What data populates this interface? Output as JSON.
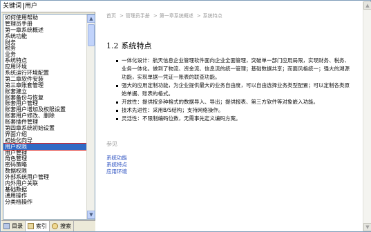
{
  "keyword": {
    "label": "关键词",
    "value": "用户"
  },
  "index_items": [
    "如何使用帮助",
    "管理员手册",
    "第一章系统概述",
    "系统功能",
    "财务",
    "税务",
    "业务",
    "系统特点",
    "应用环境",
    "系统运行环境配置",
    "第二章软件安装",
    "第三章账套管理",
    "账套建立",
    "账套备份与恢复",
    "账套用户管理",
    "账套用户增加及权限设置",
    "账套用户修改、删除",
    "账套插件管理",
    "第四章系统初始设置",
    "界面介绍",
    "初始化向导",
    "用户权限",
    "用户管理",
    "角色管理",
    "密码策略",
    "数据权限",
    "外部系统用户管理",
    "内外用户关联",
    "基础数据",
    "通用操作",
    "分类档操作"
  ],
  "selected_index": 21,
  "tabs": [
    {
      "label": "目录",
      "icon": "book-icon"
    },
    {
      "label": "索引",
      "icon": "index-icon"
    },
    {
      "label": "搜索",
      "icon": "search-icon"
    }
  ],
  "breadcrumb": [
    "首页",
    "管理员手册",
    "第一章系统概述",
    "系统特点"
  ],
  "heading": {
    "number": "1.2",
    "title": "系统特点"
  },
  "bullets": [
    "一体化设计：航天信息企业管理软件面向企业全面管理，突破单一部门应用局限，实现财务、税务、业务一体化。做到了物流、资金流、信息流的统一管理；基础数据共享；而面风格统一；强大的溯源功能，实现单据一凭证一账表的联查功能。",
    "强大的应用定制功能，为企业提供最大的业务自由度，可以自由选择业务类型配置；可以定制各类原始单据、账表的格式。",
    "开放性：提供按多种格式的数据导入、导出；提供报表、第三方软件等对象嵌入功能。",
    "技术先进性：采用B/S结构；支持网络操作。",
    "灵活性：不限制编码位数，无需事先定义编码方案。"
  ],
  "see_also": "参见",
  "links": [
    "系统功能",
    "系统特点",
    "应用环境"
  ],
  "colors": {
    "selection": "#316ac5",
    "highlight_box": "#e0201b",
    "link": "#2a4fc0"
  }
}
